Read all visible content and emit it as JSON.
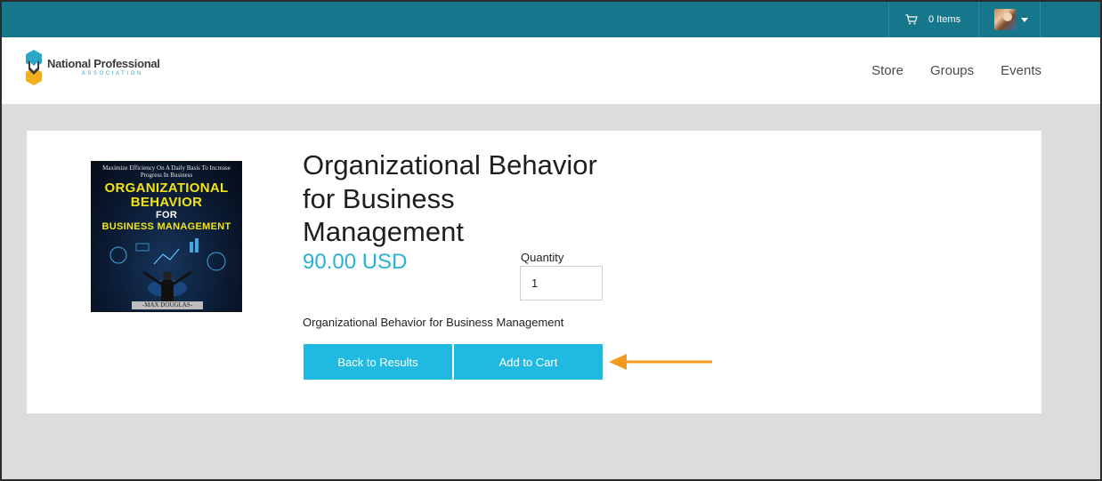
{
  "topbar": {
    "cart_label": "0 Items",
    "cart_icon": "cart-icon",
    "avatar_icon": "user-avatar"
  },
  "header": {
    "logo_name": "National Professional",
    "logo_sub": "ASSOCIATION",
    "nav": [
      "Store",
      "Groups",
      "Events"
    ]
  },
  "product": {
    "cover": {
      "tagline": "Maximize Efficiency On A Daily Basis To Increase Progress In Business",
      "title_line1": "ORGANIZATIONAL",
      "title_line2": "BEHAVIOR",
      "title_line3": "FOR",
      "title_line4": "BUSINESS MANAGEMENT",
      "author": "-MAX DOUGLAS-"
    },
    "title": "Organizational Behavior for Business Management",
    "price": "90.00 USD",
    "quantity_label": "Quantity",
    "quantity_value": "1",
    "description": "Organizational Behavior for Business Management",
    "back_button": "Back to Results",
    "add_button": "Add to Cart"
  },
  "colors": {
    "topbar": "#16768b",
    "accent": "#1fb9e1",
    "price": "#29b1d5",
    "arrow": "#f39a1e"
  }
}
